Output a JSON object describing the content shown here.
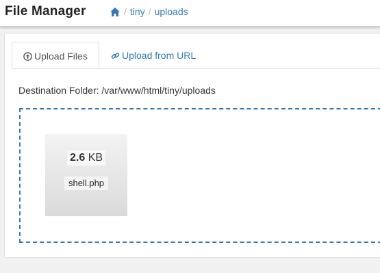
{
  "header": {
    "brand": "File Manager",
    "breadcrumb": {
      "separator": "/",
      "items": [
        "tiny",
        "uploads"
      ]
    }
  },
  "tabs": [
    {
      "label": "Upload Files",
      "icon": "arrow-circle-up-icon",
      "active": true
    },
    {
      "label": "Upload from URL",
      "icon": "link-icon",
      "active": false
    }
  ],
  "destination": {
    "text": "Destination Folder: /var/www/html/tiny/uploads"
  },
  "upload_item": {
    "size_value": "2.6",
    "size_unit": "KB",
    "filename": "shell.php"
  },
  "colors": {
    "link": "#337ab7",
    "dropzone_border": "#337ab7"
  }
}
